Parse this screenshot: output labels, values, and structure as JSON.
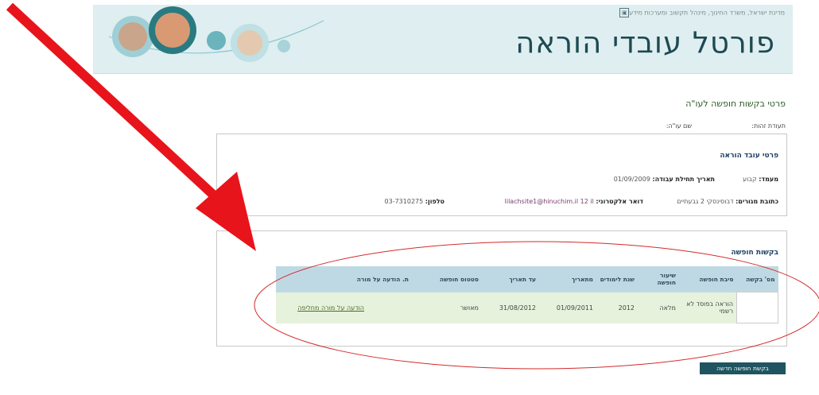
{
  "header": {
    "ministry_text": "מדינת ישראל, משרד החינוך, מינהל תקשוב ומערכות מידע",
    "portal_title": "פורטל עובדי הוראה"
  },
  "page": {
    "title": "פרטי בקשות חופשה לעו\"ה",
    "id_label": "תעודת זהות:",
    "name_label": "שם עו\"ה:"
  },
  "teacher_details": {
    "title": "פרטי עובד הוראה",
    "status_label": "מעמד:",
    "status_value": "קבוע",
    "start_label": "תאריך תחילת עבודה:",
    "start_value": "01/09/2009",
    "address_label": "כתובת מגורים:",
    "address_value": "דבוסינסקי 2 גבעתיים",
    "email_label": "דואר אלקטרוני:",
    "email_value": "lilachsite1@hinuchim.il 12 il",
    "phone_label": "טלפון:",
    "phone_value": "03-7310275"
  },
  "requests": {
    "title": "בקשות חופשה",
    "columns": [
      "מס' בקשה",
      "סיבת חופשה",
      "שיעור חופשה",
      "שנת לימודים",
      "מתאריך",
      "עד תאריך",
      "סטטוס חופשה",
      "ת. הודעה על מורה"
    ],
    "rows": [
      {
        "request_no": "",
        "reason": "הוראה בפוסד לא רשמי",
        "rate": "מלאה",
        "year": "2012",
        "from": "01/09/2011",
        "to": "31/08/2012",
        "status": "מאושר",
        "notice": "הודעה על מורה מחליפה"
      }
    ],
    "new_button": "בקשת חופשה חדשה"
  },
  "colors": {
    "annotation_arrow": "#e8141b",
    "annotation_ellipse": "#d42a2a",
    "banner": "#dfeef0",
    "table_header": "#bfd9e4",
    "table_row": "#e6f2dc"
  }
}
